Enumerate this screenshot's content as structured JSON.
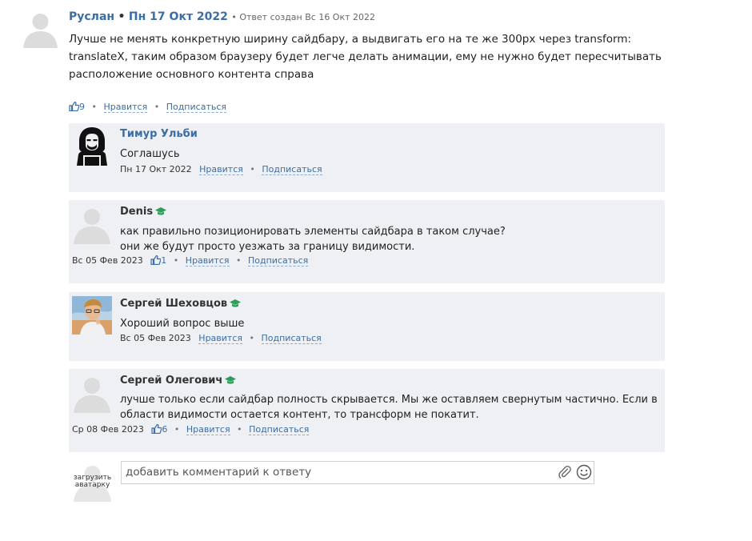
{
  "main": {
    "author": "Руслан",
    "bullet": "•",
    "date": "Пн 17 Окт 2022",
    "answer_created": "• Ответ создан Вс 16 Окт 2022",
    "text": "Лучше не менять конкретную ширину сайдбару, а выдвигать его на те же 300px через transform: translateX, таким образом браузеру будет легче делать анимации, ему не нужно будет пересчитывать расположение основного контента справа",
    "likes": "9",
    "like_label": "Нравится",
    "subscribe_label": "Подписаться"
  },
  "replies": [
    {
      "name": "Тимур Ульби",
      "text": "Соглашусь",
      "date": "Пн 17 Окт 2022",
      "like_label": "Нравится",
      "subscribe_label": "Подписаться"
    },
    {
      "name": "Denis",
      "text_line1": "как правильно позиционировать элементы сайдбара в таком случае?",
      "text_line2": "они же будут просто уезжать за границу видимости.",
      "date": "Вс 05 Фев 2023",
      "likes": "1",
      "like_label": "Нравится",
      "subscribe_label": "Подписаться"
    },
    {
      "name": "Сергей Шеховцов",
      "text": "Хороший вопрос выше",
      "date": "Вс 05 Фев 2023",
      "like_label": "Нравится",
      "subscribe_label": "Подписаться"
    },
    {
      "name": "Сергей Олегович",
      "text_line1": "лучше только если сайдбар полность скрывается. Мы же оставляем свернутым частично. Если в",
      "text_line2": "области видимости остается контент, то трансформ не покатит.",
      "date": "Ср 08 Фев 2023",
      "likes": "6",
      "like_label": "Нравится",
      "subscribe_label": "Подписаться"
    }
  ],
  "comment_form": {
    "upload_line1": "загрузить",
    "upload_line2": "аватарку",
    "placeholder": "добавить комментарий к ответу"
  },
  "icons": {
    "thumbs_up": "thumbs-up-icon",
    "graduate_cap": "graduate-cap-icon",
    "paperclip": "paperclip-icon",
    "emoji": "emoji-icon"
  },
  "colors": {
    "link": "#3a6ea5",
    "reply_bg": "#eef0f3",
    "cap_green": "#2e9e5b"
  }
}
